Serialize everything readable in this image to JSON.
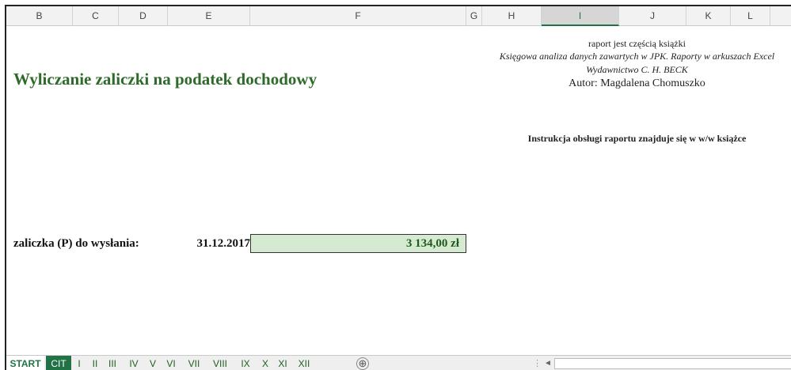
{
  "columns": [
    {
      "name": "B",
      "selected": false
    },
    {
      "name": "C",
      "selected": false
    },
    {
      "name": "D",
      "selected": false
    },
    {
      "name": "E",
      "selected": false
    },
    {
      "name": "F",
      "selected": false
    },
    {
      "name": "G",
      "selected": false
    },
    {
      "name": "H",
      "selected": false
    },
    {
      "name": "I",
      "selected": true
    },
    {
      "name": "J",
      "selected": false
    },
    {
      "name": "K",
      "selected": false
    },
    {
      "name": "L",
      "selected": false
    }
  ],
  "sheet": {
    "title": "Wyliczanie zaliczki na podatek dochodowy",
    "info_line1": "raport jest częścią książki",
    "info_line2": "Księgowa analiza danych zawartych w JPK. Raporty w arkuszach Excel",
    "info_line3": "Wydawnictwo C. H. BECK",
    "info_line4": "Autor: Magdalena Chomuszko",
    "instruction": "Instrukcja obsługi raportu znajduje się w w/w książce",
    "advance_label": "zaliczka (P) do wysłania:",
    "advance_date": "31.12.2017",
    "advance_amount": "3 134,00 zł",
    "accent_color": "#2e6b2a",
    "amount_fill": "#d6ead2"
  },
  "tabs": [
    {
      "label": "START",
      "state": "active"
    },
    {
      "label": "CIT",
      "state": "dark"
    },
    {
      "label": "I",
      "state": ""
    },
    {
      "label": "II",
      "state": ""
    },
    {
      "label": "III",
      "state": ""
    },
    {
      "label": "IV",
      "state": ""
    },
    {
      "label": "V",
      "state": ""
    },
    {
      "label": "VI",
      "state": ""
    },
    {
      "label": "VII",
      "state": ""
    },
    {
      "label": "VIII",
      "state": ""
    },
    {
      "label": "IX",
      "state": ""
    },
    {
      "label": "X",
      "state": ""
    },
    {
      "label": "XI",
      "state": ""
    },
    {
      "label": "XII",
      "state": ""
    }
  ],
  "tabbar": {
    "add_sheet": "⊕",
    "dots": "⋮",
    "scroll_left": "◄"
  }
}
